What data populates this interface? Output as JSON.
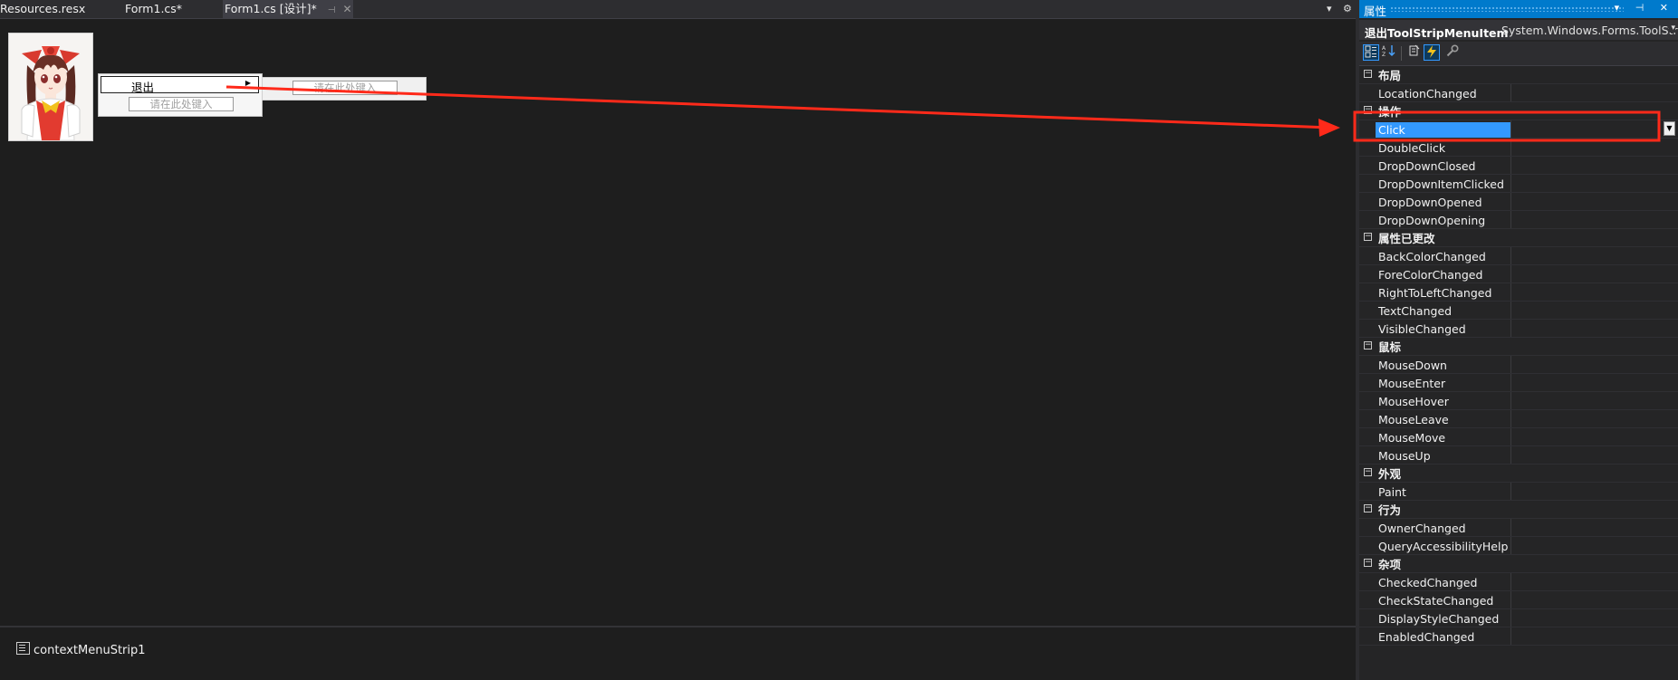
{
  "tabs": [
    {
      "label": "Resources.resx",
      "active": false
    },
    {
      "label": "Form1.cs*",
      "active": false
    },
    {
      "label": "Form1.cs [设计]*",
      "active": true
    }
  ],
  "tab_strip": {
    "pin_glyph": "⊣",
    "close_glyph": "✕",
    "overflow_glyph": "▾",
    "settings_glyph": "⚙"
  },
  "designer": {
    "context_menu": {
      "item_label": "退出",
      "type_here": "请在此处键入"
    },
    "submenu": {
      "type_here": "请在此处键入"
    }
  },
  "component_tray": {
    "items": [
      {
        "label": "contextMenuStrip1",
        "icon": "context-menu-strip-icon"
      }
    ]
  },
  "properties": {
    "title": "属性",
    "title_buttons": "▾ ⊣ ✕",
    "object_name": "退出ToolStripMenuItem",
    "object_type": "System.Windows.Forms.ToolStripMenuItem",
    "toolbar": {
      "icons": [
        "categorized-icon",
        "alphabetical-icon",
        "properties-icon",
        "events-icon",
        "property-pages-icon"
      ],
      "active": "events-icon"
    },
    "rows": [
      {
        "type": "category",
        "label": "布局"
      },
      {
        "type": "event",
        "label": "LocationChanged"
      },
      {
        "type": "category",
        "label": "操作"
      },
      {
        "type": "event",
        "label": "Click",
        "selected": true
      },
      {
        "type": "event",
        "label": "DoubleClick"
      },
      {
        "type": "event",
        "label": "DropDownClosed"
      },
      {
        "type": "event",
        "label": "DropDownItemClicked"
      },
      {
        "type": "event",
        "label": "DropDownOpened"
      },
      {
        "type": "event",
        "label": "DropDownOpening"
      },
      {
        "type": "category",
        "label": "属性已更改"
      },
      {
        "type": "event",
        "label": "BackColorChanged"
      },
      {
        "type": "event",
        "label": "ForeColorChanged"
      },
      {
        "type": "event",
        "label": "RightToLeftChanged"
      },
      {
        "type": "event",
        "label": "TextChanged"
      },
      {
        "type": "event",
        "label": "VisibleChanged"
      },
      {
        "type": "category",
        "label": "鼠标"
      },
      {
        "type": "event",
        "label": "MouseDown"
      },
      {
        "type": "event",
        "label": "MouseEnter"
      },
      {
        "type": "event",
        "label": "MouseHover"
      },
      {
        "type": "event",
        "label": "MouseLeave"
      },
      {
        "type": "event",
        "label": "MouseMove"
      },
      {
        "type": "event",
        "label": "MouseUp"
      },
      {
        "type": "category",
        "label": "外观"
      },
      {
        "type": "event",
        "label": "Paint"
      },
      {
        "type": "category",
        "label": "行为"
      },
      {
        "type": "event",
        "label": "OwnerChanged"
      },
      {
        "type": "event",
        "label": "QueryAccessibilityHelp"
      },
      {
        "type": "category",
        "label": "杂项"
      },
      {
        "type": "event",
        "label": "CheckedChanged"
      },
      {
        "type": "event",
        "label": "CheckStateChanged"
      },
      {
        "type": "event",
        "label": "DisplayStyleChanged"
      },
      {
        "type": "event",
        "label": "EnabledChanged"
      }
    ]
  },
  "colors": {
    "accent": "#007acc",
    "selection": "#3399ff",
    "annotation": "#ff2a1a"
  }
}
